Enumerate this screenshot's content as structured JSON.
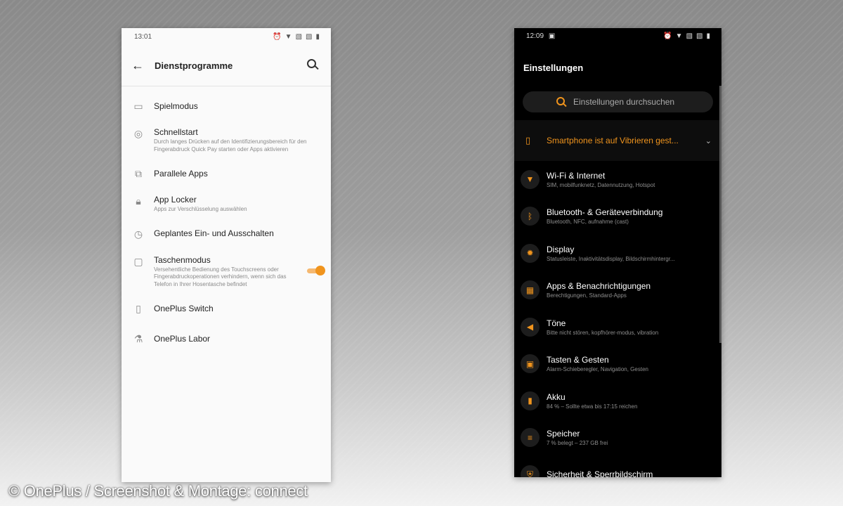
{
  "light_phone": {
    "status": {
      "time": "13:01",
      "icons": [
        "alarm-icon",
        "wifi-icon",
        "no-sim-icon",
        "no-sim-icon",
        "battery-icon"
      ]
    },
    "title": "Dienstprogramme",
    "items": [
      {
        "icon": "gamepad-icon",
        "title": "Spielmodus",
        "subtitle": ""
      },
      {
        "icon": "fingerprint-icon",
        "title": "Schnellstart",
        "subtitle": "Durch langes Drücken auf den Identifizierungsbereich für den Fingerabdruck Quick Pay starten oder Apps aktivieren"
      },
      {
        "icon": "parallel-apps-icon",
        "title": "Parallele Apps",
        "subtitle": ""
      },
      {
        "icon": "lock-icon",
        "title": "App Locker",
        "subtitle": "Apps zur Verschlüsselung auswählen"
      },
      {
        "icon": "clock-icon",
        "title": "Geplantes Ein- und Ausschalten",
        "subtitle": ""
      },
      {
        "icon": "pocket-icon",
        "title": "Taschenmodus",
        "subtitle": "Versehentliche Bedienung des Touchscreens oder Fingerabdruckoperationen verhindern, wenn sich das Telefon in Ihrer Hosentasche befindet",
        "toggle_on": true
      },
      {
        "icon": "phone-switch-icon",
        "title": "OnePlus Switch",
        "subtitle": ""
      },
      {
        "icon": "flask-icon",
        "title": "OnePlus Labor",
        "subtitle": ""
      }
    ]
  },
  "dark_phone": {
    "status": {
      "time": "12:09",
      "icons": [
        "image-icon",
        "alarm-icon",
        "wifi-icon",
        "no-sim-icon",
        "no-sim-icon",
        "battery-icon"
      ]
    },
    "title": "Einstellungen",
    "search_placeholder": "Einstellungen durchsuchen",
    "suggestion": "Smartphone ist auf Vibrieren gest...",
    "items": [
      {
        "icon": "wifi-icon",
        "title": "Wi-Fi & Internet",
        "subtitle": "SIM, mobilfunknetz, Datennutzung, Hotspot"
      },
      {
        "icon": "bluetooth-icon",
        "title": "Bluetooth- & Geräteverbindung",
        "subtitle": "Bluetooth, NFC, aufnahme (cast)"
      },
      {
        "icon": "brightness-icon",
        "title": "Display",
        "subtitle": "Statusleiste, Inaktivitätsdisplay, Bildschirmhintergr..."
      },
      {
        "icon": "apps-grid-icon",
        "title": "Apps & Benachrichtigungen",
        "subtitle": "Berechtigungen, Standard-Apps"
      },
      {
        "icon": "speaker-icon",
        "title": "Töne",
        "subtitle": "Bitte nicht stören, kopfhörer-modus, vibration"
      },
      {
        "icon": "buttons-icon",
        "title": "Tasten & Gesten",
        "subtitle": "Alarm-Schieberegler, Navigation, Gesten"
      },
      {
        "icon": "battery-icon",
        "title": "Akku",
        "subtitle": "84 % – Sollte etwa bis 17:15 reichen"
      },
      {
        "icon": "storage-icon",
        "title": "Speicher",
        "subtitle": "7 % belegt – 237 GB frei"
      },
      {
        "icon": "security-icon",
        "title": "Sicherheit & Sperrbildschirm",
        "subtitle": ""
      }
    ]
  },
  "credit": "© OnePlus / Screenshot & Montage: connect",
  "colors": {
    "accent": "#f0941d",
    "dark_bg": "#000000",
    "light_bg": "#fafafa"
  }
}
